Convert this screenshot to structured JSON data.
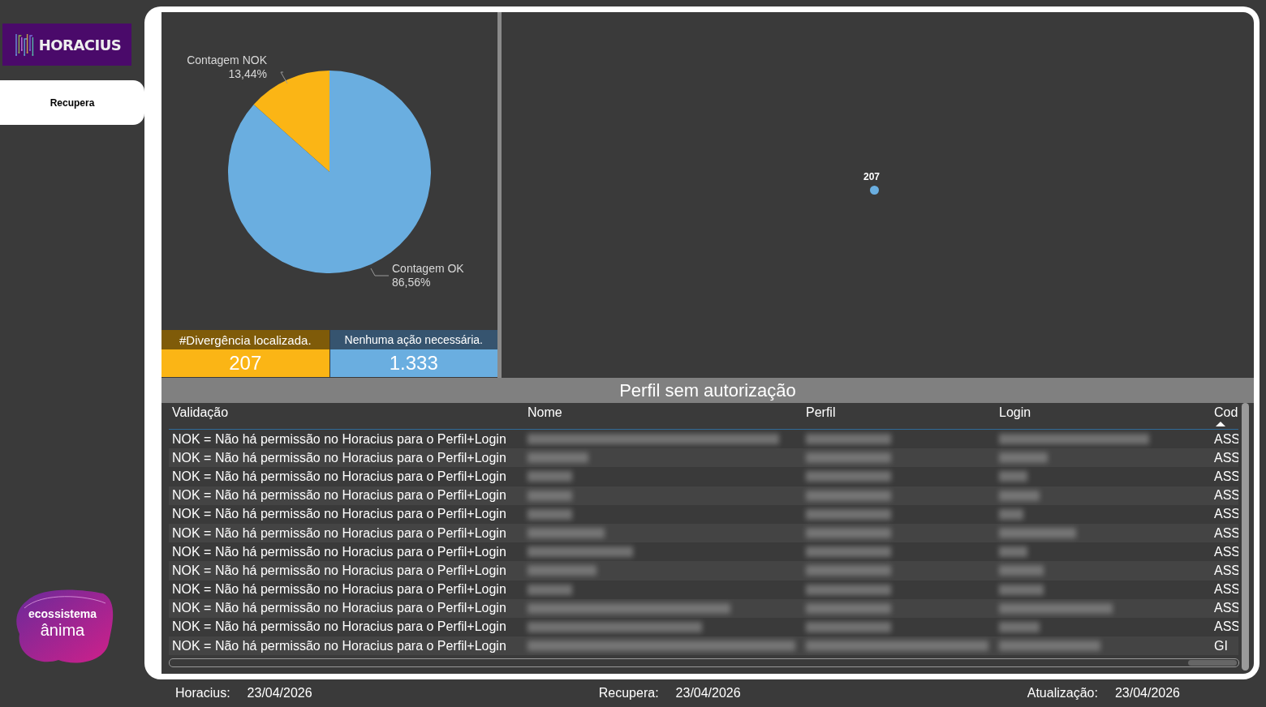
{
  "sidebar": {
    "logo_text": "HORACIUS",
    "items": [
      {
        "label": "Recupera",
        "selected": true
      }
    ],
    "brand_line_1": "ecossistema",
    "brand_line_2": "ânima"
  },
  "pie": {
    "chart_data": {
      "type": "pie",
      "categories": [
        "Contagem NOK",
        "Contagem OK"
      ],
      "values": [
        13.44,
        86.56
      ],
      "value_labels": [
        "13,44%",
        "86,56%"
      ]
    }
  },
  "cards": [
    {
      "label": "#Divergência localizada.",
      "value": "207",
      "kind": "warning"
    },
    {
      "label": "Nenhuma ação necessária.",
      "value": "1.333",
      "kind": "ok"
    }
  ],
  "scatter": {
    "point_label": "207"
  },
  "table": {
    "title": "Perfil sem autorização",
    "columns": [
      {
        "label": "Validação",
        "kind": "text",
        "sorted": false
      },
      {
        "label": "Nome",
        "kind": "blurred",
        "sorted": false
      },
      {
        "label": "Perfil",
        "kind": "blurred",
        "sorted": false
      },
      {
        "label": "Login",
        "kind": "blurred",
        "sorted": false
      },
      {
        "label": "Cod",
        "kind": "code",
        "sorted": true
      }
    ],
    "rows": [
      {
        "validation": "NOK = Não há permissão no Horacius para o Perfil+Login",
        "code": "ASS"
      },
      {
        "validation": "NOK = Não há permissão no Horacius para o Perfil+Login",
        "code": "ASS"
      },
      {
        "validation": "NOK = Não há permissão no Horacius para o Perfil+Login",
        "code": "ASS"
      },
      {
        "validation": "NOK = Não há permissão no Horacius para o Perfil+Login",
        "code": "ASS"
      },
      {
        "validation": "NOK = Não há permissão no Horacius para o Perfil+Login",
        "code": "ASS"
      },
      {
        "validation": "NOK = Não há permissão no Horacius para o Perfil+Login",
        "code": "ASS"
      },
      {
        "validation": "NOK = Não há permissão no Horacius para o Perfil+Login",
        "code": "ASS"
      },
      {
        "validation": "NOK = Não há permissão no Horacius para o Perfil+Login",
        "code": "ASS"
      },
      {
        "validation": "NOK = Não há permissão no Horacius para o Perfil+Login",
        "code": "ASS"
      },
      {
        "validation": "NOK = Não há permissão no Horacius para o Perfil+Login",
        "code": "ASS"
      },
      {
        "validation": "NOK = Não há permissão no Horacius para o Perfil+Login",
        "code": "ASS"
      },
      {
        "validation": "NOK = Não há permissão no Horacius para o Perfil+Login",
        "code": "GI"
      }
    ]
  },
  "footer": [
    {
      "label": "Horacius:",
      "date": "23/04/2026"
    },
    {
      "label": "Recupera:",
      "date": "23/04/2026"
    },
    {
      "label": "Atualização:",
      "date": "23/04/2026"
    }
  ]
}
